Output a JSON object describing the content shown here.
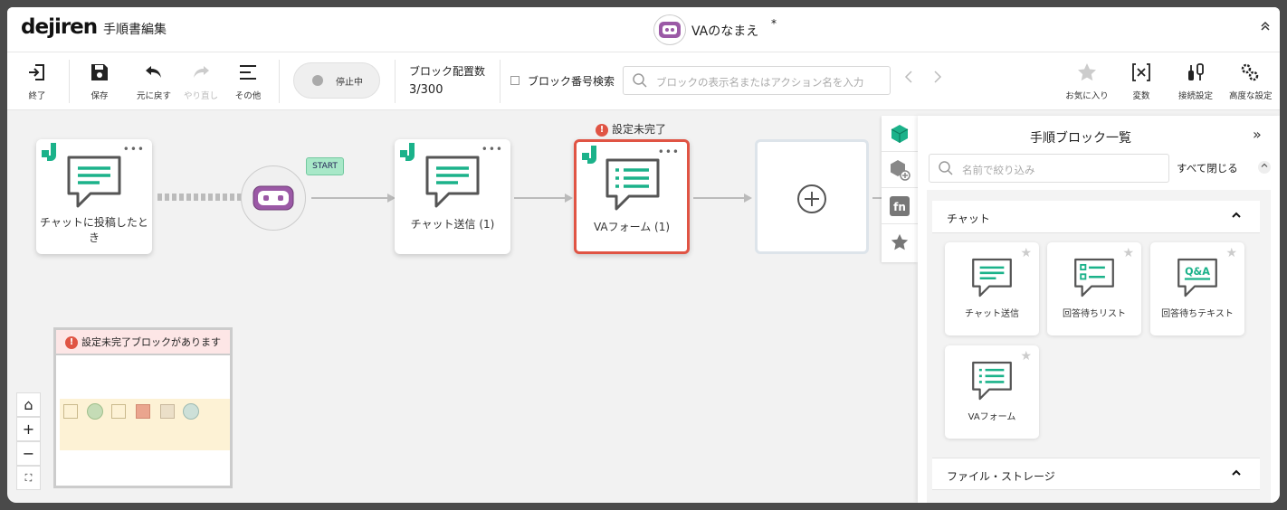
{
  "header": {
    "logo": "dejiren",
    "title": "手順書編集",
    "va_name": "VAのなまえ",
    "va_unsaved": "*"
  },
  "toolbar": {
    "exit": "終了",
    "save": "保存",
    "undo": "元に戻す",
    "redo": "やり直し",
    "other": "その他",
    "status": "停止中",
    "block_count_label": "ブロック配置数",
    "block_count_value": "3/300",
    "block_number_search": "ブロック番号検索",
    "search_placeholder": "ブロックの表示名またはアクション名を入力",
    "favorites": "お気に入り",
    "variables": "変数",
    "connection_settings": "接続設定",
    "advanced_settings": "高度な設定"
  },
  "flow": {
    "trigger_label": "チャットに投稿したとき",
    "start_label": "START",
    "block1_label": "チャット送信 (1)",
    "block2_label": "VAフォーム (1)",
    "block2_error": "設定未完了"
  },
  "minimap": {
    "warning": "設定未完了ブロックがあります"
  },
  "zoom": {
    "home": "⌂",
    "zoom_in": "+",
    "zoom_out": "−",
    "fit": "⛶"
  },
  "panel": {
    "title": "手順ブロック一覧",
    "close": "»",
    "filter_placeholder": "名前で絞り込み",
    "collapse_all": "すべて閉じる",
    "categories": [
      {
        "name": "チャット",
        "tiles": [
          "チャット送信",
          "回答待ちリスト",
          "回答待ちテキスト",
          "VAフォーム"
        ]
      },
      {
        "name": "ファイル・ストレージ"
      }
    ],
    "qa_text": "Q&A"
  },
  "colors": {
    "accent": "#1bb28a",
    "va_purple": "#9b59a6",
    "error": "#e05444"
  }
}
